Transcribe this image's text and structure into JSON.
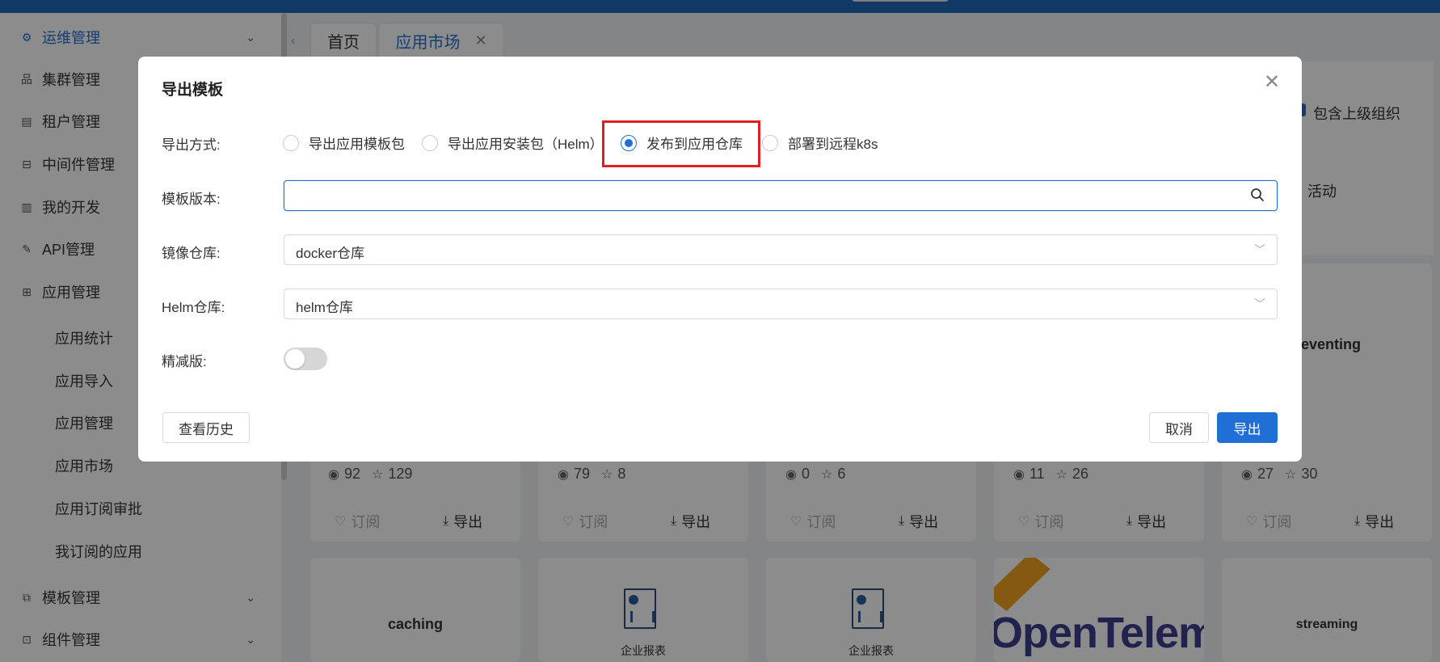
{
  "sidebar": {
    "items": [
      {
        "label": "运维管理",
        "icon": "settings-icon",
        "active": true
      },
      {
        "label": "集群管理",
        "icon": "cluster-icon"
      },
      {
        "label": "租户管理",
        "icon": "tenant-icon"
      },
      {
        "label": "中间件管理",
        "icon": "middleware-icon"
      },
      {
        "label": "我的开发",
        "icon": "dev-icon"
      },
      {
        "label": "API管理",
        "icon": "api-icon"
      },
      {
        "label": "应用管理",
        "icon": "grid-icon"
      },
      {
        "label": "模板管理",
        "icon": "template-icon"
      },
      {
        "label": "组件管理",
        "icon": "component-icon"
      }
    ],
    "sub_items": [
      "应用统计",
      "应用导入",
      "应用管理",
      "应用市场",
      "应用订阅审批",
      "我订阅的应用"
    ]
  },
  "tabs": [
    {
      "label": "首页"
    },
    {
      "label": "应用市场",
      "active": true
    }
  ],
  "background": {
    "include_parent_org": "包含上级组织",
    "activity": "活动",
    "eventing": "eventing",
    "cards_row1": [
      {
        "views": "92",
        "stars": "129"
      },
      {
        "views": "79",
        "stars": "8"
      },
      {
        "views": "0",
        "stars": "6"
      },
      {
        "views": "11",
        "stars": "26"
      },
      {
        "views": "27",
        "stars": "30"
      }
    ],
    "subscribe_label": "订阅",
    "export_label": "导出",
    "cards_row2": [
      {
        "title": "caching"
      },
      {
        "subtitle": "企业报表"
      },
      {
        "subtitle": "企业报表"
      },
      {
        "title": "OpenTelem"
      },
      {
        "title": "streaming"
      }
    ]
  },
  "modal": {
    "title": "导出模板",
    "export_method_label": "导出方式:",
    "export_options": [
      {
        "label": "导出应用模板包",
        "checked": false
      },
      {
        "label": "导出应用安装包（Helm）",
        "checked": false
      },
      {
        "label": "发布到应用仓库",
        "checked": true
      },
      {
        "label": "部署到远程k8s",
        "checked": false
      }
    ],
    "template_version_label": "模板版本:",
    "template_version_value": "",
    "image_repo_label": "镜像仓库:",
    "image_repo_value": "docker仓库",
    "helm_repo_label": "Helm仓库:",
    "helm_repo_value": "helm仓库",
    "lite_label": "精减版:",
    "lite_enabled": false,
    "history_button": "查看历史",
    "cancel_button": "取消",
    "export_button": "导出"
  },
  "colors": {
    "primary": "#1f6fd6",
    "highlight": "#e02020"
  }
}
